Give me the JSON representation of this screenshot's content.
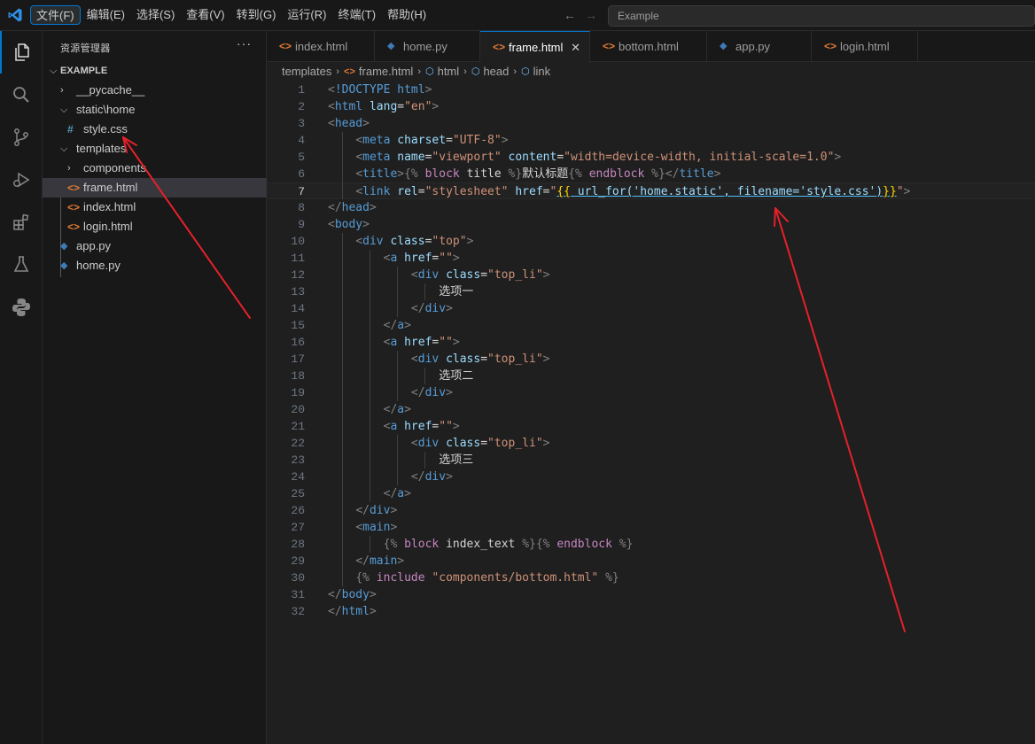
{
  "menu": [
    "文件(F)",
    "编辑(E)",
    "选择(S)",
    "查看(V)",
    "转到(G)",
    "运行(R)",
    "终端(T)",
    "帮助(H)"
  ],
  "search_placeholder": "Example",
  "sidebar": {
    "title": "资源管理器",
    "more": "···",
    "root": "EXAMPLE",
    "items": [
      {
        "label": "__pycache__",
        "type": "folder",
        "expanded": false
      },
      {
        "label": "static\\home",
        "type": "folder",
        "expanded": true
      },
      {
        "label": "style.css",
        "type": "css"
      },
      {
        "label": "templates",
        "type": "folder",
        "expanded": true
      },
      {
        "label": "components",
        "type": "folder",
        "expanded": false
      },
      {
        "label": "frame.html",
        "type": "html",
        "selected": true
      },
      {
        "label": "index.html",
        "type": "html"
      },
      {
        "label": "login.html",
        "type": "html"
      },
      {
        "label": "app.py",
        "type": "python"
      },
      {
        "label": "home.py",
        "type": "python"
      }
    ]
  },
  "tabs": [
    {
      "label": "index.html",
      "type": "html"
    },
    {
      "label": "home.py",
      "type": "python"
    },
    {
      "label": "frame.html",
      "type": "html",
      "active": true
    },
    {
      "label": "bottom.html",
      "type": "html"
    },
    {
      "label": "app.py",
      "type": "python"
    },
    {
      "label": "login.html",
      "type": "html"
    }
  ],
  "breadcrumb": [
    "templates",
    "frame.html",
    "html",
    "head",
    "link"
  ],
  "current_line": 7,
  "code_lines": [
    "<!DOCTYPE html>",
    "<html lang=\"en\">",
    "<head>",
    "    <meta charset=\"UTF-8\">",
    "    <meta name=\"viewport\" content=\"width=device-width, initial-scale=1.0\">",
    "    <title>{% block title %}默认标题{% endblock %}</title>",
    "    <link rel=\"stylesheet\" href=\"{{ url_for('home.static', filename='style.css')}}\">",
    "</head>",
    "<body>",
    "    <div class=\"top\">",
    "        <a href=\"\">",
    "            <div class=\"top_li\">",
    "                选项一",
    "            </div>",
    "        </a>",
    "        <a href=\"\">",
    "            <div class=\"top_li\">",
    "                选项二",
    "            </div>",
    "        </a>",
    "        <a href=\"\">",
    "            <div class=\"top_li\">",
    "                选项三",
    "            </div>",
    "        </a>",
    "    </div>",
    "    <main>",
    "        {% block index_text %}{% endblock %}",
    "    </main>",
    "    {% include \"components/bottom.html\" %}",
    "</body>",
    "</html>"
  ],
  "colors": {
    "accent": "#0078d4",
    "tag": "#569cd6",
    "attr": "#9cdcfe",
    "string": "#ce9178",
    "text": "#d4d4d4",
    "punct": "#808080",
    "jinja_keyword": "#c586c0",
    "url_underline": "#4fc1ff",
    "html_icon": "#e37933",
    "css_icon": "#519aba",
    "python_icon": "#3e7ab8",
    "annotation_arrow": "#e5212a"
  },
  "icons": {
    "activity": [
      "explorer-icon",
      "search-icon",
      "source-control-icon",
      "run-debug-icon",
      "extensions-icon",
      "testing-icon",
      "python-icon"
    ]
  }
}
